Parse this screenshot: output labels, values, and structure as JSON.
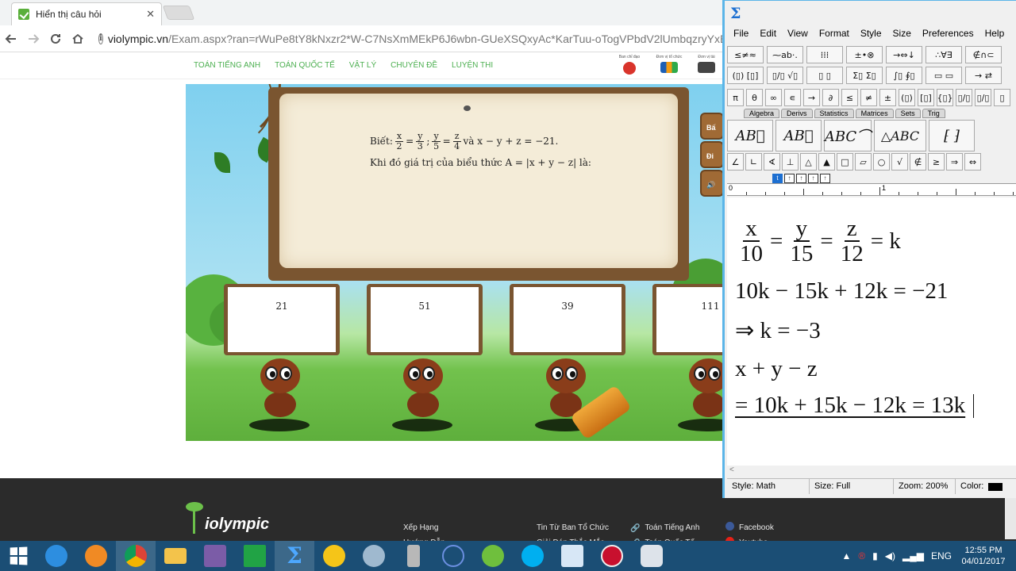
{
  "browser": {
    "tab_title": "Hiển thị câu hỏi",
    "tab_close": "✕",
    "url_host": "violympic.vn",
    "url_path": "/Exam.aspx?ran=rWuPe8tY8kNxzr2*W-C7NsXmMEkP6J6wbn-GUeXSQxyAc*KarTuu-oTogVPbdV2lUmbqzryYxB3"
  },
  "site": {
    "nav": [
      "TOÁN TIẾNG ANH",
      "TOÁN QUỐC TẾ",
      "VẬT LÝ",
      "CHUYÊN ĐỀ",
      "LUYỆN THI"
    ],
    "sponsors": [
      "Ban chỉ đạo",
      "Đơn vị tổ chức",
      "Đơn vị tài"
    ]
  },
  "question": {
    "intro": "Biết:",
    "fracs": [
      {
        "num": "x",
        "den": "2"
      },
      {
        "num": "y",
        "den": "3"
      },
      {
        "num": "y",
        "den": "5"
      },
      {
        "num": "z",
        "den": "4"
      }
    ],
    "eq_sign": "=",
    "sep": ";",
    "tail": "và x − y + z = −21.",
    "line2": "Khi đó giá trị của biểu thức A = |x + y − z| là:"
  },
  "answers": [
    "21",
    "51",
    "39",
    "111"
  ],
  "side_buttons": [
    "Bấ",
    "Đi",
    "🔊"
  ],
  "footer": {
    "brand": "iolympic",
    "col1": [
      "Xếp Hạng",
      "Hướng Dẫn"
    ],
    "col2": [
      "Tin Từ Ban Tổ Chức",
      "Giải Đáp Thắc Mắc"
    ],
    "col3": [
      "Toán Tiếng Anh",
      "Toán Quốc Tế"
    ],
    "col4": [
      "Facebook",
      "Youtube"
    ]
  },
  "mathtype": {
    "menu": [
      "File",
      "Edit",
      "View",
      "Format",
      "Style",
      "Size",
      "Preferences",
      "Help"
    ],
    "palette_row1": [
      "≤≠≈",
      "⁓ab·.",
      "⁞⁞⁞",
      "±•⊗",
      "→⇔↓",
      "∴∀∃",
      "∉∩⊂"
    ],
    "palette_row2": [
      "(▯) [▯]",
      "▯/▯ √▯",
      "▯ ▯",
      "Σ▯ Σ▯",
      "∫▯ ∮▯",
      "▭ ▭",
      "→ ⇄"
    ],
    "palette_row3": [
      "π",
      "θ",
      "∞",
      "∊",
      "→",
      "∂",
      "≤",
      "≠",
      "±",
      "(▯)",
      "[▯]",
      "{▯}",
      "▯/▯",
      "▯/▯",
      "▯"
    ],
    "tabs": [
      "Algebra",
      "Derivs",
      "Statistics",
      "Matrices",
      "Sets",
      "Trig"
    ],
    "templates": [
      "AB⃗",
      "AB⃗",
      "ABC⌒",
      "△ABC",
      "⁅ ⁆"
    ],
    "symbol_row": [
      "∠",
      "∟",
      "∢",
      "⊥",
      "△",
      "▲",
      "□",
      "▱",
      "○",
      "√",
      "∉",
      "≥",
      "⇒",
      "⇔"
    ],
    "ruler_labels": [
      "0",
      "1"
    ],
    "ruler_btn_active": "t",
    "eq1_fracs": [
      {
        "num": "x",
        "den": "10"
      },
      {
        "num": "y",
        "den": "15"
      },
      {
        "num": "z",
        "den": "12"
      }
    ],
    "eq1_tail": "= k",
    "eq2": "10k − 15k + 12k = −21",
    "eq3": "⇒ k = −3",
    "eq4": "x + y − z",
    "eq5": "= 10k + 15k − 12k = 13k",
    "scroll_arrow": "<",
    "status": {
      "style": "Style: Math",
      "size": "Size: Full",
      "zoom": "Zoom: 200%",
      "color": "Color:"
    }
  },
  "taskbar": {
    "lang": "ENG",
    "time": "12:55 PM",
    "date": "04/01/2017"
  }
}
